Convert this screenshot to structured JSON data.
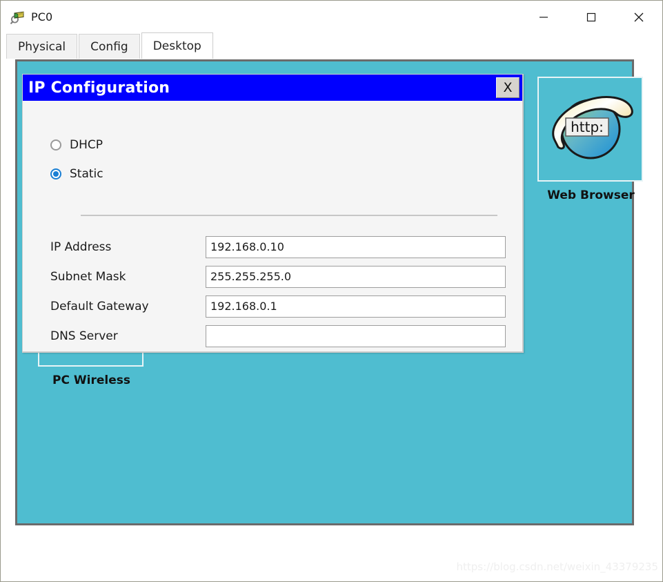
{
  "window": {
    "title": "PC0",
    "icon": "packet-tracer-pc-icon",
    "controls": {
      "minimize": "minimize-icon",
      "maximize": "maximize-icon",
      "close": "close-icon"
    }
  },
  "tabs": [
    {
      "label": "Physical",
      "active": false
    },
    {
      "label": "Config",
      "active": false
    },
    {
      "label": "Desktop",
      "active": true
    }
  ],
  "desktop": {
    "background_color": "#4fbdd0",
    "icons": [
      {
        "label": "Web Browser",
        "icon": "web-browser-globe-icon",
        "badge_text": "http:"
      },
      {
        "label": "PC Wireless",
        "icon": "pc-wireless-icon"
      }
    ]
  },
  "ip_config_dialog": {
    "title": "IP Configuration",
    "titlebar_color": "#0000ff",
    "close_label": "X",
    "modes": [
      {
        "label": "DHCP",
        "selected": false
      },
      {
        "label": "Static",
        "selected": true
      }
    ],
    "fields": [
      {
        "label": "IP Address",
        "value": "192.168.0.10",
        "placeholder": ""
      },
      {
        "label": "Subnet Mask",
        "value": "255.255.255.0",
        "placeholder": ""
      },
      {
        "label": "Default Gateway",
        "value": "192.168.0.1",
        "placeholder": ""
      },
      {
        "label": "DNS Server",
        "value": "",
        "placeholder": ""
      }
    ]
  },
  "watermark": "https://blog.csdn.net/weixin_43379235"
}
